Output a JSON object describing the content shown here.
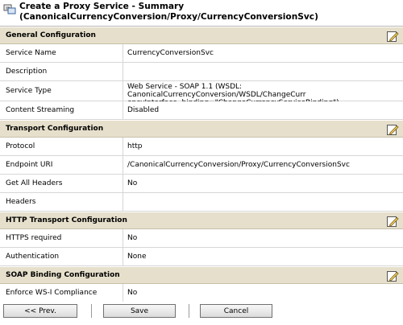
{
  "title": {
    "line1": "Create a Proxy Service - Summary",
    "line2": "(CanonicalCurrencyConversion/Proxy/CurrencyConversionSvc)",
    "icon": "proxy-service-icon"
  },
  "sections": {
    "general": {
      "title": "General Configuration",
      "rows": [
        {
          "label": "Service Name",
          "value": "CurrencyConversionSvc"
        },
        {
          "label": "Description",
          "value": ""
        },
        {
          "label": "Service Type",
          "value_line1": "Web Service - SOAP 1.1 (WSDL: CanonicalCurrencyConversion/WSDL/ChangeCurr",
          "value_line2": "encyInterface, binding=\"ChangeCurrencyServiceBinding\")"
        },
        {
          "label": "Content Streaming",
          "value": "Disabled"
        }
      ]
    },
    "transport": {
      "title": "Transport Configuration",
      "rows": [
        {
          "label": "Protocol",
          "value": "http"
        },
        {
          "label": "Endpoint URI",
          "value": "/CanonicalCurrencyConversion/Proxy/CurrencyConversionSvc"
        },
        {
          "label": "Get All Headers",
          "value": "No"
        },
        {
          "label": "Headers",
          "value": ""
        }
      ]
    },
    "http_transport": {
      "title": "HTTP Transport Configuration",
      "rows": [
        {
          "label": "HTTPS required",
          "value": "No"
        },
        {
          "label": "Authentication",
          "value": "None"
        }
      ]
    },
    "soap_binding": {
      "title": "SOAP Binding Configuration",
      "rows": [
        {
          "label": "Enforce WS-I Compliance",
          "value": "No"
        }
      ]
    }
  },
  "buttons": {
    "prev": "<< Prev.",
    "save": "Save",
    "cancel": "Cancel"
  },
  "colors": {
    "section_header_bg": "#e6dfcb",
    "border": "#d6d6d6"
  }
}
